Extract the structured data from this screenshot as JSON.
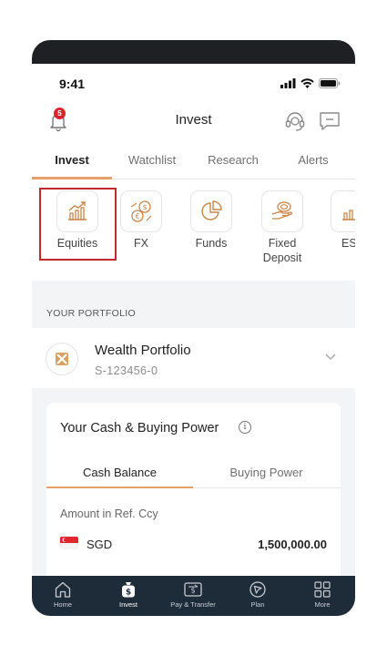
{
  "status": {
    "time": "9:41"
  },
  "header": {
    "title": "Invest",
    "notification_count": "5"
  },
  "tabs": [
    {
      "label": "Invest",
      "active": true
    },
    {
      "label": "Watchlist",
      "active": false
    },
    {
      "label": "Research",
      "active": false
    },
    {
      "label": "Alerts",
      "active": false
    }
  ],
  "products": [
    {
      "label": "Equities",
      "icon": "chart-growth-icon"
    },
    {
      "label": "FX",
      "icon": "currency-exchange-icon"
    },
    {
      "label": "Funds",
      "icon": "pie-chart-icon"
    },
    {
      "label": "Fixed Deposit",
      "icon": "hand-coin-icon"
    },
    {
      "label": "ES",
      "icon": "chart-growth-icon"
    }
  ],
  "portfolio_section": {
    "label": "YOUR PORTFOLIO"
  },
  "portfolio": {
    "name": "Wealth Portfolio",
    "id": "S-123456-0"
  },
  "cash": {
    "title": "Your Cash & Buying Power",
    "tab_cash": "Cash Balance",
    "tab_buying": "Buying Power",
    "amount_label": "Amount in Ref. Ccy",
    "currency": "SGD",
    "amount": "1,500,000.00"
  },
  "nav": [
    {
      "label": "Home",
      "icon": "home-icon"
    },
    {
      "label": "Invest",
      "icon": "money-bag-icon"
    },
    {
      "label": "Pay & Transfer",
      "icon": "transfer-icon"
    },
    {
      "label": "Plan",
      "icon": "compass-icon"
    },
    {
      "label": "More",
      "icon": "grid-icon"
    }
  ],
  "colors": {
    "accent": "#e5a06a",
    "highlight": "#c1272d",
    "nav_bg": "#1e2c3a",
    "badge": "#d9262e"
  }
}
